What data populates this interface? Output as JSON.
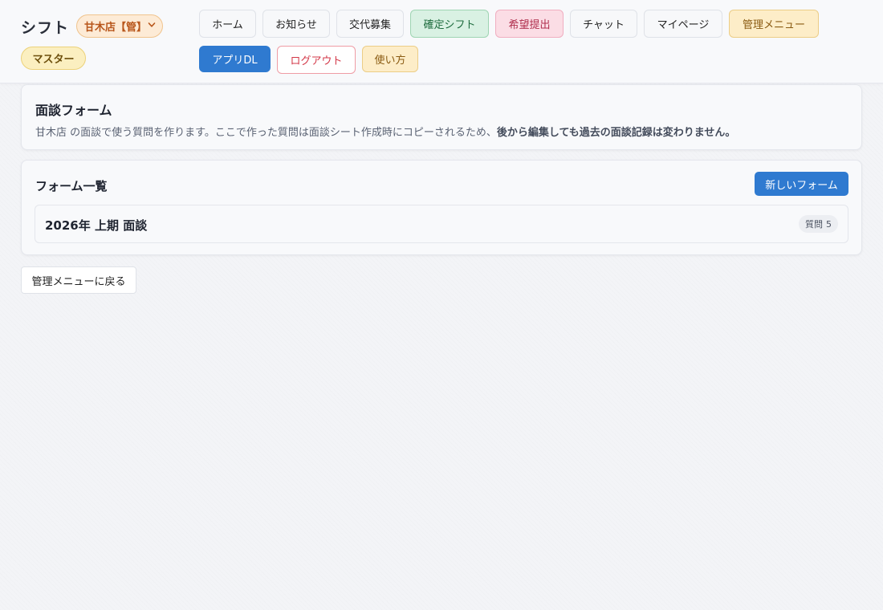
{
  "header": {
    "app_title": "シフト",
    "store_select": "甘木店【管】",
    "role_badge": "マスター",
    "nav": [
      {
        "label": "ホーム"
      },
      {
        "label": "お知らせ"
      },
      {
        "label": "交代募集"
      },
      {
        "label": "確定シフト"
      },
      {
        "label": "希望提出"
      },
      {
        "label": "チャット"
      },
      {
        "label": "マイページ"
      },
      {
        "label": "管理メニュー"
      },
      {
        "label": "アプリDL"
      },
      {
        "label": "ログアウト"
      },
      {
        "label": "使い方"
      }
    ]
  },
  "intro": {
    "title": "面談フォーム",
    "desc_normal": "甘木店 の面談で使う質問を作ります。ここで作った質問は面談シート作成時にコピーされるため、",
    "desc_bold": "後から編集しても過去の面談記録は変わりません。"
  },
  "form_list": {
    "title": "フォーム一覧",
    "new_button": "新しいフォーム",
    "items": [
      {
        "name": "2026年 上期 面談",
        "question_label": "質問",
        "question_count": "5"
      }
    ]
  },
  "back_button": "管理メニューに戻る",
  "colors": {
    "primary": "#2f7ad0",
    "confirm_green": "#d9f1e3",
    "request_pink": "#fbdde5",
    "admin_amber": "#fdedc8",
    "logout_red": "#d33848"
  }
}
